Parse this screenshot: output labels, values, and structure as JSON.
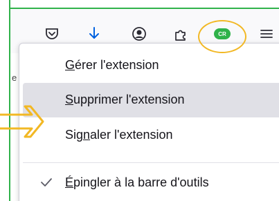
{
  "toolbar": {
    "icons": [
      "pocket-icon",
      "download-icon",
      "account-icon",
      "extensions-puzzle-icon",
      "extension-cr-icon",
      "hamburger-menu-icon"
    ],
    "extension_badge_text": "CR",
    "extension_badge_color": "#2fb24a"
  },
  "page_fragment_text": "e",
  "context_menu": {
    "items": [
      {
        "label": "Gérer l'extension",
        "mnemonic": "G",
        "rest": "érer l'extension",
        "hovered": false
      },
      {
        "label": "Supprimer l'extension",
        "mnemonic": "S",
        "rest": "upprimer l'extension",
        "hovered": true
      },
      {
        "label": "Signaler l'extension",
        "pre": "Sig",
        "mnemonic": "n",
        "rest": "aler l'extension",
        "hovered": false
      },
      {
        "label": "Épingler à la barre d'outils",
        "mnemonic": "É",
        "rest": "pingler à la barre d'outils",
        "checked": true
      }
    ]
  },
  "colors": {
    "frame": "#2fb24a",
    "annotation": "#f2b824",
    "accent_blue": "#0061e0",
    "hover": "#e0e0e6"
  }
}
